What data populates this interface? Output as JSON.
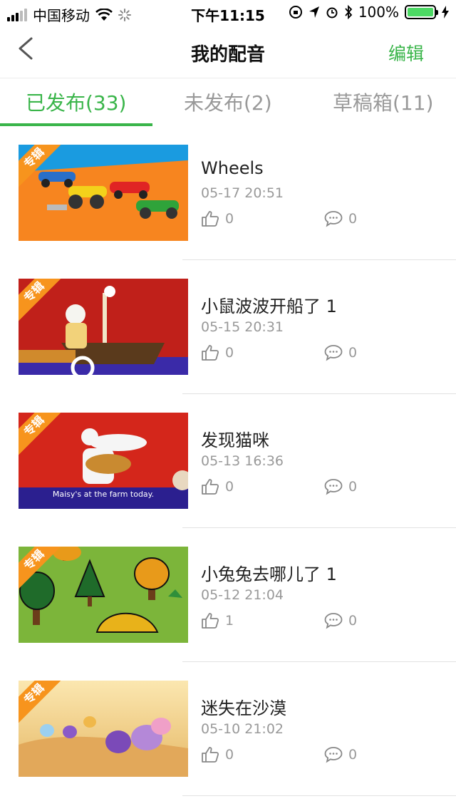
{
  "status_bar": {
    "carrier": "中国移动",
    "time": "下午11:15",
    "battery": "100%"
  },
  "nav": {
    "title": "我的配音",
    "edit_label": "编辑"
  },
  "tabs": [
    {
      "label": "已发布(33)",
      "active": true
    },
    {
      "label": "未发布(2)",
      "active": false
    },
    {
      "label": "草稿箱(11)",
      "active": false
    }
  ],
  "items": [
    {
      "badge": "专辑",
      "title": "Wheels",
      "date": "05-17 20:51",
      "likes": "0",
      "comments": "0"
    },
    {
      "badge": "专辑",
      "title": "小鼠波波开船了 1",
      "date": "05-15 20:31",
      "likes": "0",
      "comments": "0"
    },
    {
      "badge": "专辑",
      "title": "发现猫咪",
      "date": "05-13 16:36",
      "likes": "0",
      "comments": "0",
      "caption": "Maisy's at the farm today."
    },
    {
      "badge": "专辑",
      "title": "小兔兔去哪儿了 1",
      "date": "05-12 21:04",
      "likes": "1",
      "comments": "0"
    },
    {
      "badge": "专辑",
      "title": "迷失在沙漠",
      "date": "05-10 21:02",
      "likes": "0",
      "comments": "0"
    }
  ]
}
